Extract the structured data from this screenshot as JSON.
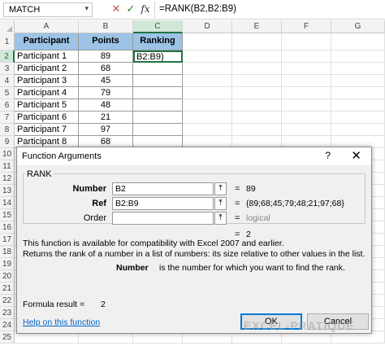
{
  "formula_bar": {
    "name_box": "MATCH",
    "name_box_dropdown": "▾",
    "cancel_icon": "✕",
    "enter_icon": "✓",
    "fx_icon": "fx",
    "formula": "=RANK(B2,B2:B9)"
  },
  "columns": [
    "A",
    "B",
    "C",
    "D",
    "E",
    "F",
    "G"
  ],
  "rows": [
    "1",
    "2",
    "3",
    "4",
    "5",
    "6",
    "7",
    "8",
    "9",
    "10",
    "11",
    "12",
    "13",
    "14",
    "15",
    "16",
    "17",
    "18",
    "19",
    "20",
    "21",
    "22",
    "23",
    "24",
    "25"
  ],
  "table": {
    "headers": [
      "Participant",
      "Points",
      "Ranking"
    ],
    "data": [
      [
        "Participant 1",
        "89",
        "B2:B9)"
      ],
      [
        "Participant 2",
        "68",
        ""
      ],
      [
        "Participant 3",
        "45",
        ""
      ],
      [
        "Participant 4",
        "79",
        ""
      ],
      [
        "Participant 5",
        "48",
        ""
      ],
      [
        "Participant 6",
        "21",
        ""
      ],
      [
        "Participant 7",
        "97",
        ""
      ],
      [
        "Participant 8",
        "68",
        ""
      ]
    ]
  },
  "dialog": {
    "title": "Function Arguments",
    "help_icon": "?",
    "close_icon": "✕",
    "function_name": "RANK",
    "args": [
      {
        "label": "Number",
        "value": "B2",
        "result": "89",
        "bold": true
      },
      {
        "label": "Ref",
        "value": "B2:B9",
        "result": "{89;68;45;79;48;21;97;68}",
        "bold": true
      },
      {
        "label": "Order",
        "value": "",
        "result": "logical",
        "bold": false
      }
    ],
    "collapse_icon": "⤒",
    "equals": "=",
    "function_result": "2",
    "description_1": "This function is available for compatibility with Excel 2007 and earlier.",
    "description_2": "Returns the rank of a number in a list of numbers: its size relative to other values in the list.",
    "arg_help_name": "Number",
    "arg_help_text": "is the number for which you want to find the rank.",
    "formula_result_label": "Formula result =",
    "formula_result_value": "2",
    "help_link": "Help on this function",
    "ok_label": "OK",
    "cancel_label": "Cancel"
  },
  "watermark": "EXCEL-PRATIQUE",
  "colors": {
    "header_fill": "#9dc3e6",
    "excel_green": "#217346",
    "dialog_bg": "#f0f0f0",
    "link": "#0066cc"
  }
}
